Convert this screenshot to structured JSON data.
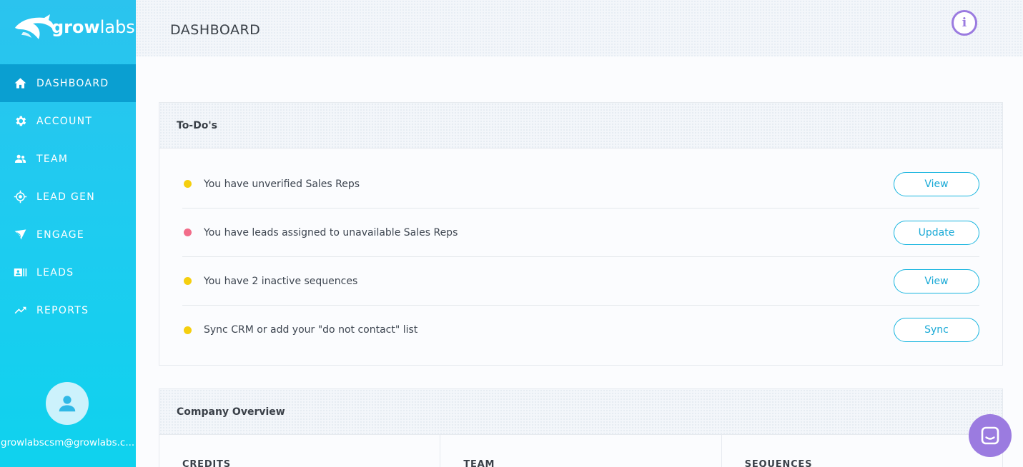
{
  "brand": {
    "name_bold": "grow",
    "name_light": "labs"
  },
  "sidebar": {
    "items": [
      {
        "label": "DASHBOARD",
        "icon": "home-icon",
        "active": true
      },
      {
        "label": "ACCOUNT",
        "icon": "gear-icon",
        "active": false
      },
      {
        "label": "TEAM",
        "icon": "people-icon",
        "active": false
      },
      {
        "label": "LEAD GEN",
        "icon": "target-icon",
        "active": false
      },
      {
        "label": "ENGAGE",
        "icon": "send-icon",
        "active": false
      },
      {
        "label": "LEADS",
        "icon": "contact-card-icon",
        "active": false
      },
      {
        "label": "REPORTS",
        "icon": "trending-up-icon",
        "active": false
      }
    ],
    "user_email": "growlabscsm@growlabs.c..."
  },
  "header": {
    "title": "DASHBOARD",
    "info_icon": "info-icon"
  },
  "todos": {
    "title": "To-Do's",
    "items": [
      {
        "text": "You have unverified Sales Reps",
        "action": "View",
        "status_color": "#f5cf0f"
      },
      {
        "text": "You have leads assigned to unavailable Sales Reps",
        "action": "Update",
        "status_color": "#f26d8a"
      },
      {
        "text": "You have 2 inactive sequences",
        "action": "View",
        "status_color": "#f5cf0f"
      },
      {
        "text": "Sync CRM or add your \"do not contact\" list",
        "action": "Sync",
        "status_color": "#f5cf0f"
      }
    ]
  },
  "company": {
    "title": "Company Overview",
    "columns": [
      "CREDITS",
      "TEAM",
      "SEQUENCES"
    ]
  },
  "colors": {
    "accent": "#18b5df",
    "sidebar_active": "#0a9fd1",
    "purple": "#9b7be0"
  }
}
